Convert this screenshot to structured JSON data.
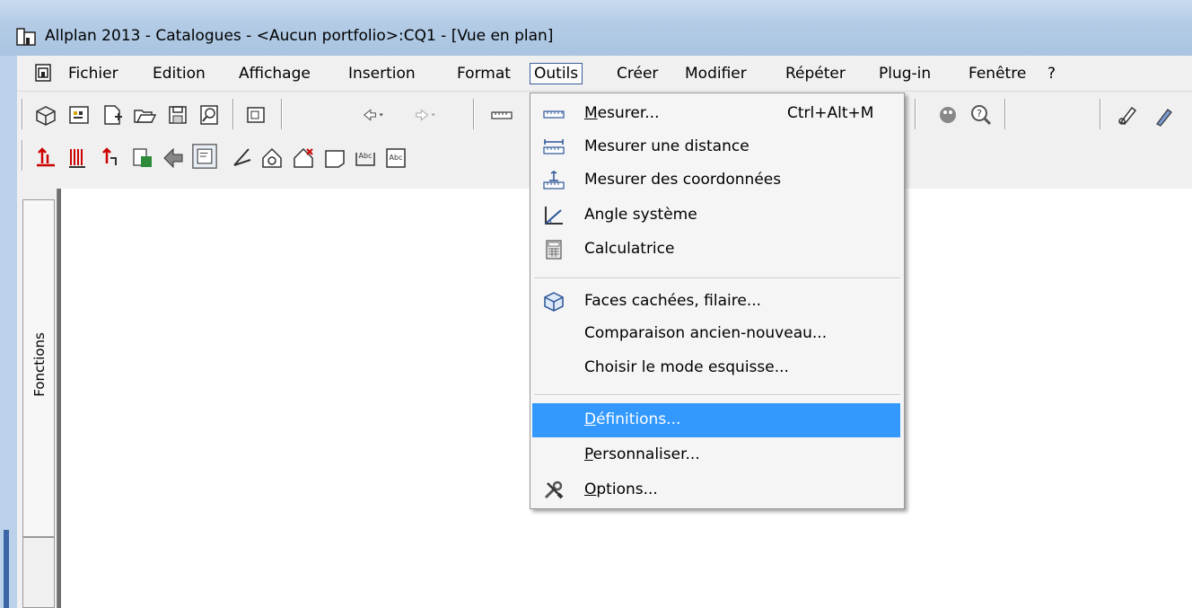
{
  "window": {
    "title": "Allplan 2013 - Catalogues - <Aucun portfolio>:CQ1 - [Vue en plan]"
  },
  "menubar": {
    "items": [
      {
        "label": "Fichier"
      },
      {
        "label": "Edition"
      },
      {
        "label": "Affichage"
      },
      {
        "label": "Insertion"
      },
      {
        "label": "Format"
      },
      {
        "label": "Outils",
        "active": true
      },
      {
        "label": "Créer"
      },
      {
        "label": "Modifier"
      },
      {
        "label": "Répéter"
      },
      {
        "label": "Plug-in"
      },
      {
        "label": "Fenêtre"
      },
      {
        "label": "?"
      }
    ]
  },
  "left_panel": {
    "tab_label": "Fonctions"
  },
  "outils_menu": {
    "items": [
      {
        "label_first": "M",
        "label_rest": "esurer...",
        "shortcut": "Ctrl+Alt+M",
        "icon": "ruler-icon"
      },
      {
        "label": "Mesurer une distance",
        "icon": "measure-distance-icon"
      },
      {
        "label": "Mesurer des coordonnées",
        "icon": "measure-coordinates-icon"
      },
      {
        "label": "Angle système",
        "icon": "system-angle-icon"
      },
      {
        "label": "Calculatrice",
        "icon": "calculator-icon"
      },
      {
        "label": "Faces cachées, filaire...",
        "icon": "hidden-faces-icon"
      },
      {
        "label": "Comparaison ancien-nouveau..."
      },
      {
        "label": "Choisir le mode esquisse..."
      },
      {
        "label_first": "D",
        "label_rest": "éfinitions...",
        "highlighted": true
      },
      {
        "label_first": "P",
        "label_rest": "ersonnaliser..."
      },
      {
        "label_first": "O",
        "label_rest": "ptions...",
        "icon": "tools-icon"
      }
    ]
  },
  "colors": {
    "titlebar": "#b3cbe5",
    "highlight": "#3399ff",
    "menu_bg": "#f5f5f5"
  }
}
